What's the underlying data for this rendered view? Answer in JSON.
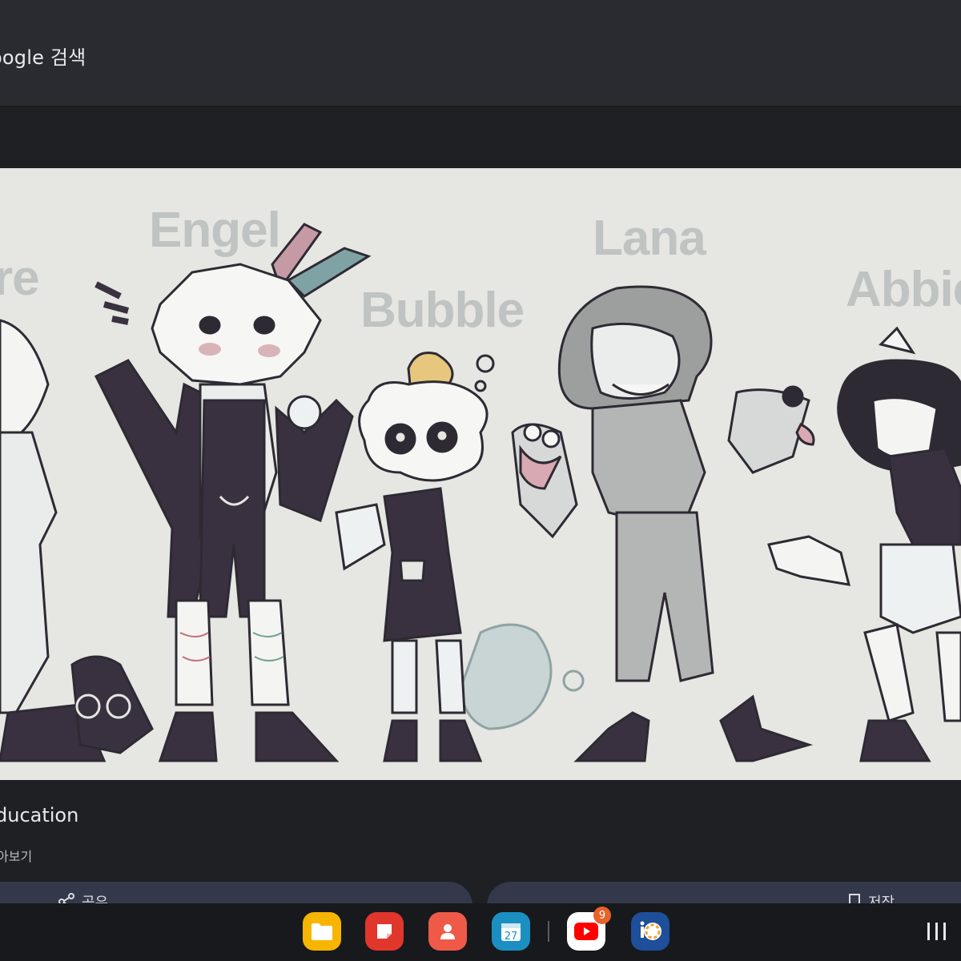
{
  "header": {
    "title": "oogle 검색"
  },
  "image": {
    "names": [
      "re",
      "Engel",
      "Bubble",
      "Lana",
      "Abbie"
    ]
  },
  "result": {
    "caption": "ducation",
    "subcaption": "아보기"
  },
  "actions": {
    "share_label": "공유",
    "save_label": "저장"
  },
  "taskbar": {
    "apps": [
      {
        "name": "files",
        "color": "#f7b500"
      },
      {
        "name": "notes",
        "color": "#e0362c"
      },
      {
        "name": "contacts",
        "color": "#ee5a47"
      },
      {
        "name": "calendar",
        "color": "#1b8fc2",
        "label": "27"
      },
      {
        "name": "youtube",
        "color": "#ffffff",
        "badge": "9"
      },
      {
        "name": "ibis-paint",
        "color": "#1d4f9a"
      }
    ]
  }
}
